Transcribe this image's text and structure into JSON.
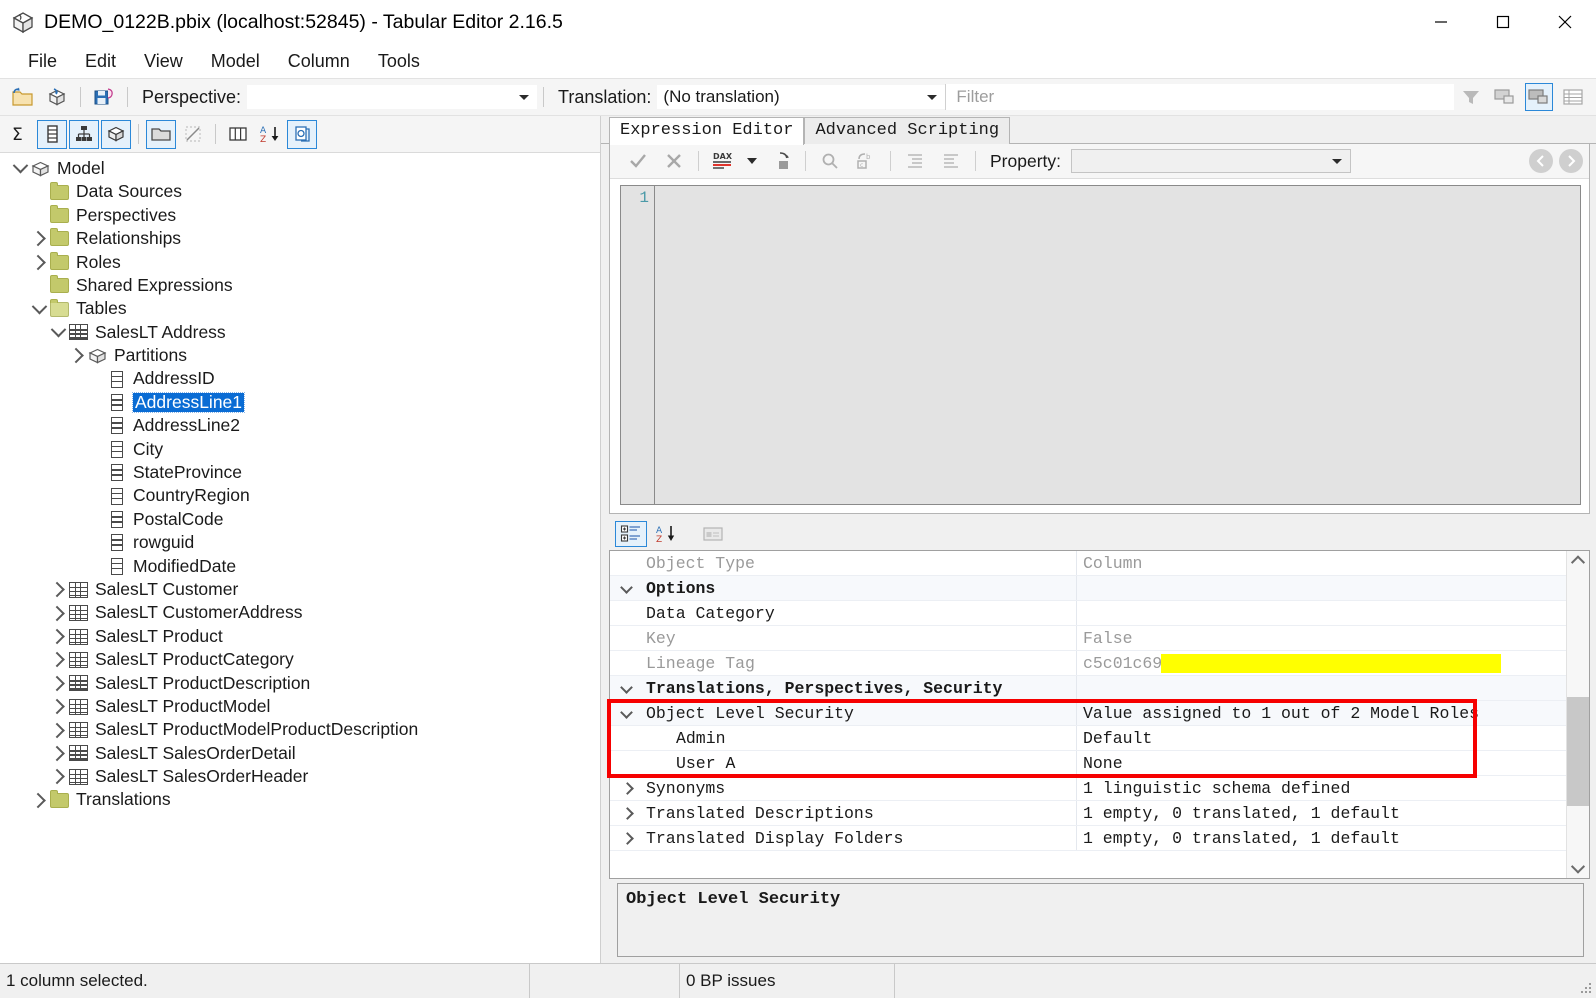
{
  "window": {
    "title": "DEMO_0122B.pbix (localhost:52845) - Tabular Editor 2.16.5",
    "app_icon": "tabular-editor-icon",
    "minimize": "—",
    "maximize": "□",
    "close": "✕"
  },
  "menu": {
    "items": [
      {
        "label": "File"
      },
      {
        "label": "Edit"
      },
      {
        "label": "View"
      },
      {
        "label": "Model"
      },
      {
        "label": "Column"
      },
      {
        "label": "Tools"
      }
    ]
  },
  "toolbar": {
    "icons": [
      {
        "name": "open-file-icon"
      },
      {
        "name": "refresh-model-icon"
      },
      {
        "name": "save-icon"
      }
    ],
    "perspective_label": "Perspective:",
    "perspective_value": "",
    "translation_label": "Translation:",
    "translation_value": "(No translation)",
    "filter_placeholder": "Filter",
    "right_icons": [
      {
        "name": "filter-funnel-icon",
        "active": false
      },
      {
        "name": "show-hidden-objects-icon",
        "active": false
      },
      {
        "name": "show-display-folders-icon",
        "active": true
      },
      {
        "name": "show-all-columns-icon",
        "active": false
      }
    ]
  },
  "toolbar2": {
    "icons": [
      {
        "name": "measures-icon",
        "active": true
      },
      {
        "name": "columns-icon",
        "active": true
      },
      {
        "name": "hierarchies-icon",
        "active": true
      },
      {
        "name": "partitions-icon",
        "active": true
      },
      {
        "name": "display-folders-icon",
        "active": true
      },
      {
        "name": "hidden-objects-icon",
        "active": false
      },
      {
        "name": "table-columns-icon",
        "active": false
      },
      {
        "name": "sort-alpha-icon",
        "active": false
      },
      {
        "name": "perspectives-icon",
        "active": true
      }
    ]
  },
  "tree": {
    "nodes": [
      {
        "label": "Model",
        "indent": 0,
        "icon": "cube-icon",
        "twist": "down",
        "selected": false
      },
      {
        "label": "Data Sources",
        "indent": 1,
        "icon": "folder-icon",
        "twist": "none",
        "selected": false
      },
      {
        "label": "Perspectives",
        "indent": 1,
        "icon": "folder-icon",
        "twist": "none",
        "selected": false
      },
      {
        "label": "Relationships",
        "indent": 1,
        "icon": "folder-icon",
        "twist": "right",
        "selected": false
      },
      {
        "label": "Roles",
        "indent": 1,
        "icon": "folder-icon",
        "twist": "right",
        "selected": false
      },
      {
        "label": "Shared Expressions",
        "indent": 1,
        "icon": "folder-icon",
        "twist": "none",
        "selected": false
      },
      {
        "label": "Tables",
        "indent": 1,
        "icon": "folder-open-icon",
        "twist": "down",
        "selected": false
      },
      {
        "label": "SalesLT Address",
        "indent": 2,
        "icon": "table-icon",
        "twist": "down",
        "selected": false
      },
      {
        "label": "Partitions",
        "indent": 3,
        "icon": "cube-icon",
        "twist": "right",
        "selected": false
      },
      {
        "label": "AddressID",
        "indent": 4,
        "icon": "column-icon",
        "twist": "none",
        "selected": false
      },
      {
        "label": "AddressLine1",
        "indent": 4,
        "icon": "column-icon",
        "twist": "none",
        "selected": true
      },
      {
        "label": "AddressLine2",
        "indent": 4,
        "icon": "column-icon",
        "twist": "none",
        "selected": false
      },
      {
        "label": "City",
        "indent": 4,
        "icon": "column-icon",
        "twist": "none",
        "selected": false
      },
      {
        "label": "StateProvince",
        "indent": 4,
        "icon": "column-icon",
        "twist": "none",
        "selected": false
      },
      {
        "label": "CountryRegion",
        "indent": 4,
        "icon": "column-icon",
        "twist": "none",
        "selected": false
      },
      {
        "label": "PostalCode",
        "indent": 4,
        "icon": "column-icon",
        "twist": "none",
        "selected": false
      },
      {
        "label": "rowguid",
        "indent": 4,
        "icon": "column-icon",
        "twist": "none",
        "selected": false
      },
      {
        "label": "ModifiedDate",
        "indent": 4,
        "icon": "column-icon",
        "twist": "none",
        "selected": false
      },
      {
        "label": "SalesLT Customer",
        "indent": 2,
        "icon": "table-icon",
        "twist": "right",
        "selected": false
      },
      {
        "label": "SalesLT CustomerAddress",
        "indent": 2,
        "icon": "table-icon",
        "twist": "right",
        "selected": false
      },
      {
        "label": "SalesLT Product",
        "indent": 2,
        "icon": "table-icon",
        "twist": "right",
        "selected": false
      },
      {
        "label": "SalesLT ProductCategory",
        "indent": 2,
        "icon": "table-icon",
        "twist": "right",
        "selected": false
      },
      {
        "label": "SalesLT ProductDescription",
        "indent": 2,
        "icon": "table-icon",
        "twist": "right",
        "selected": false
      },
      {
        "label": "SalesLT ProductModel",
        "indent": 2,
        "icon": "table-icon",
        "twist": "right",
        "selected": false
      },
      {
        "label": "SalesLT ProductModelProductDescription",
        "indent": 2,
        "icon": "table-icon",
        "twist": "right",
        "selected": false
      },
      {
        "label": "SalesLT SalesOrderDetail",
        "indent": 2,
        "icon": "table-icon",
        "twist": "right",
        "selected": false
      },
      {
        "label": "SalesLT SalesOrderHeader",
        "indent": 2,
        "icon": "table-icon",
        "twist": "right",
        "selected": false
      },
      {
        "label": "Translations",
        "indent": 1,
        "icon": "folder-icon",
        "twist": "right",
        "selected": false
      }
    ]
  },
  "editor": {
    "tabs": [
      {
        "label": "Expression Editor",
        "active": true
      },
      {
        "label": "Advanced Scripting",
        "active": false
      }
    ],
    "toolbar_icons": [
      {
        "name": "accept-check-icon"
      },
      {
        "name": "cancel-x-icon"
      },
      {
        "name": "dax-format-icon"
      },
      {
        "name": "dax-dropdown-icon"
      },
      {
        "name": "paste-icon"
      },
      {
        "name": "find-icon"
      },
      {
        "name": "replace-icon"
      },
      {
        "name": "indent-increase-icon"
      },
      {
        "name": "indent-decrease-icon"
      }
    ],
    "property_label": "Property:",
    "property_value": "",
    "nav_back": "nav-back-icon",
    "nav_forward": "nav-forward-icon",
    "line_numbers": [
      "1"
    ],
    "code": ""
  },
  "propgrid": {
    "toolbar_icons": [
      {
        "name": "categorized-view-icon",
        "active": true
      },
      {
        "name": "alphabetical-sort-icon",
        "active": false
      },
      {
        "name": "property-pages-icon",
        "active": false
      }
    ],
    "rows": [
      {
        "name": "Object Type",
        "value": "Column",
        "indent": 0,
        "twist": "none",
        "bold": false,
        "dim_name": true,
        "dim_value": true,
        "alt": false,
        "highlight": false
      },
      {
        "name": "Options",
        "value": "",
        "indent": 0,
        "twist": "down",
        "bold": true,
        "dim_name": false,
        "dim_value": false,
        "alt": true,
        "highlight": false
      },
      {
        "name": "Data Category",
        "value": "",
        "indent": 0,
        "twist": "none",
        "bold": false,
        "dim_name": false,
        "dim_value": false,
        "alt": false,
        "highlight": false
      },
      {
        "name": "Key",
        "value": "False",
        "indent": 0,
        "twist": "none",
        "bold": false,
        "dim_name": true,
        "dim_value": true,
        "alt": false,
        "highlight": false
      },
      {
        "name": "Lineage Tag",
        "value": "c5c01c69",
        "indent": 0,
        "twist": "none",
        "bold": false,
        "dim_name": true,
        "dim_value": true,
        "alt": false,
        "highlight": false
      },
      {
        "name": "Translations, Perspectives, Security",
        "value": "",
        "indent": 0,
        "twist": "down",
        "bold": true,
        "dim_name": false,
        "dim_value": false,
        "alt": true,
        "highlight": false
      },
      {
        "name": "Object Level Security",
        "value": "Value assigned to 1 out of 2 Model Roles",
        "indent": 0,
        "twist": "down",
        "bold": false,
        "dim_name": false,
        "dim_value": false,
        "alt": true,
        "highlight": true
      },
      {
        "name": "Admin",
        "value": "Default",
        "indent": 1,
        "twist": "none",
        "bold": false,
        "dim_name": false,
        "dim_value": false,
        "alt": false,
        "highlight": true
      },
      {
        "name": "User A",
        "value": "None",
        "indent": 1,
        "twist": "none",
        "bold": false,
        "dim_name": false,
        "dim_value": false,
        "alt": false,
        "highlight": true
      },
      {
        "name": "Synonyms",
        "value": "1 linguistic schema defined",
        "indent": 0,
        "twist": "right",
        "bold": false,
        "dim_name": false,
        "dim_value": false,
        "alt": false,
        "highlight": false
      },
      {
        "name": "Translated Descriptions",
        "value": "1 empty, 0 translated, 1 default",
        "indent": 0,
        "twist": "right",
        "bold": false,
        "dim_name": false,
        "dim_value": false,
        "alt": false,
        "highlight": false
      },
      {
        "name": "Translated Display Folders",
        "value": "1 empty, 0 translated, 1 default",
        "indent": 0,
        "twist": "right",
        "bold": false,
        "dim_name": false,
        "dim_value": false,
        "alt": false,
        "highlight": false
      }
    ],
    "description_title": "Object Level Security",
    "description_body": ""
  },
  "annotations": {
    "redaction_color": "#ffff00",
    "highlight_color": "#f60000"
  },
  "statusbar": {
    "selection_text": "1 column selected.",
    "middle_text": "",
    "bp_text": "0 BP issues",
    "right_text": ""
  }
}
